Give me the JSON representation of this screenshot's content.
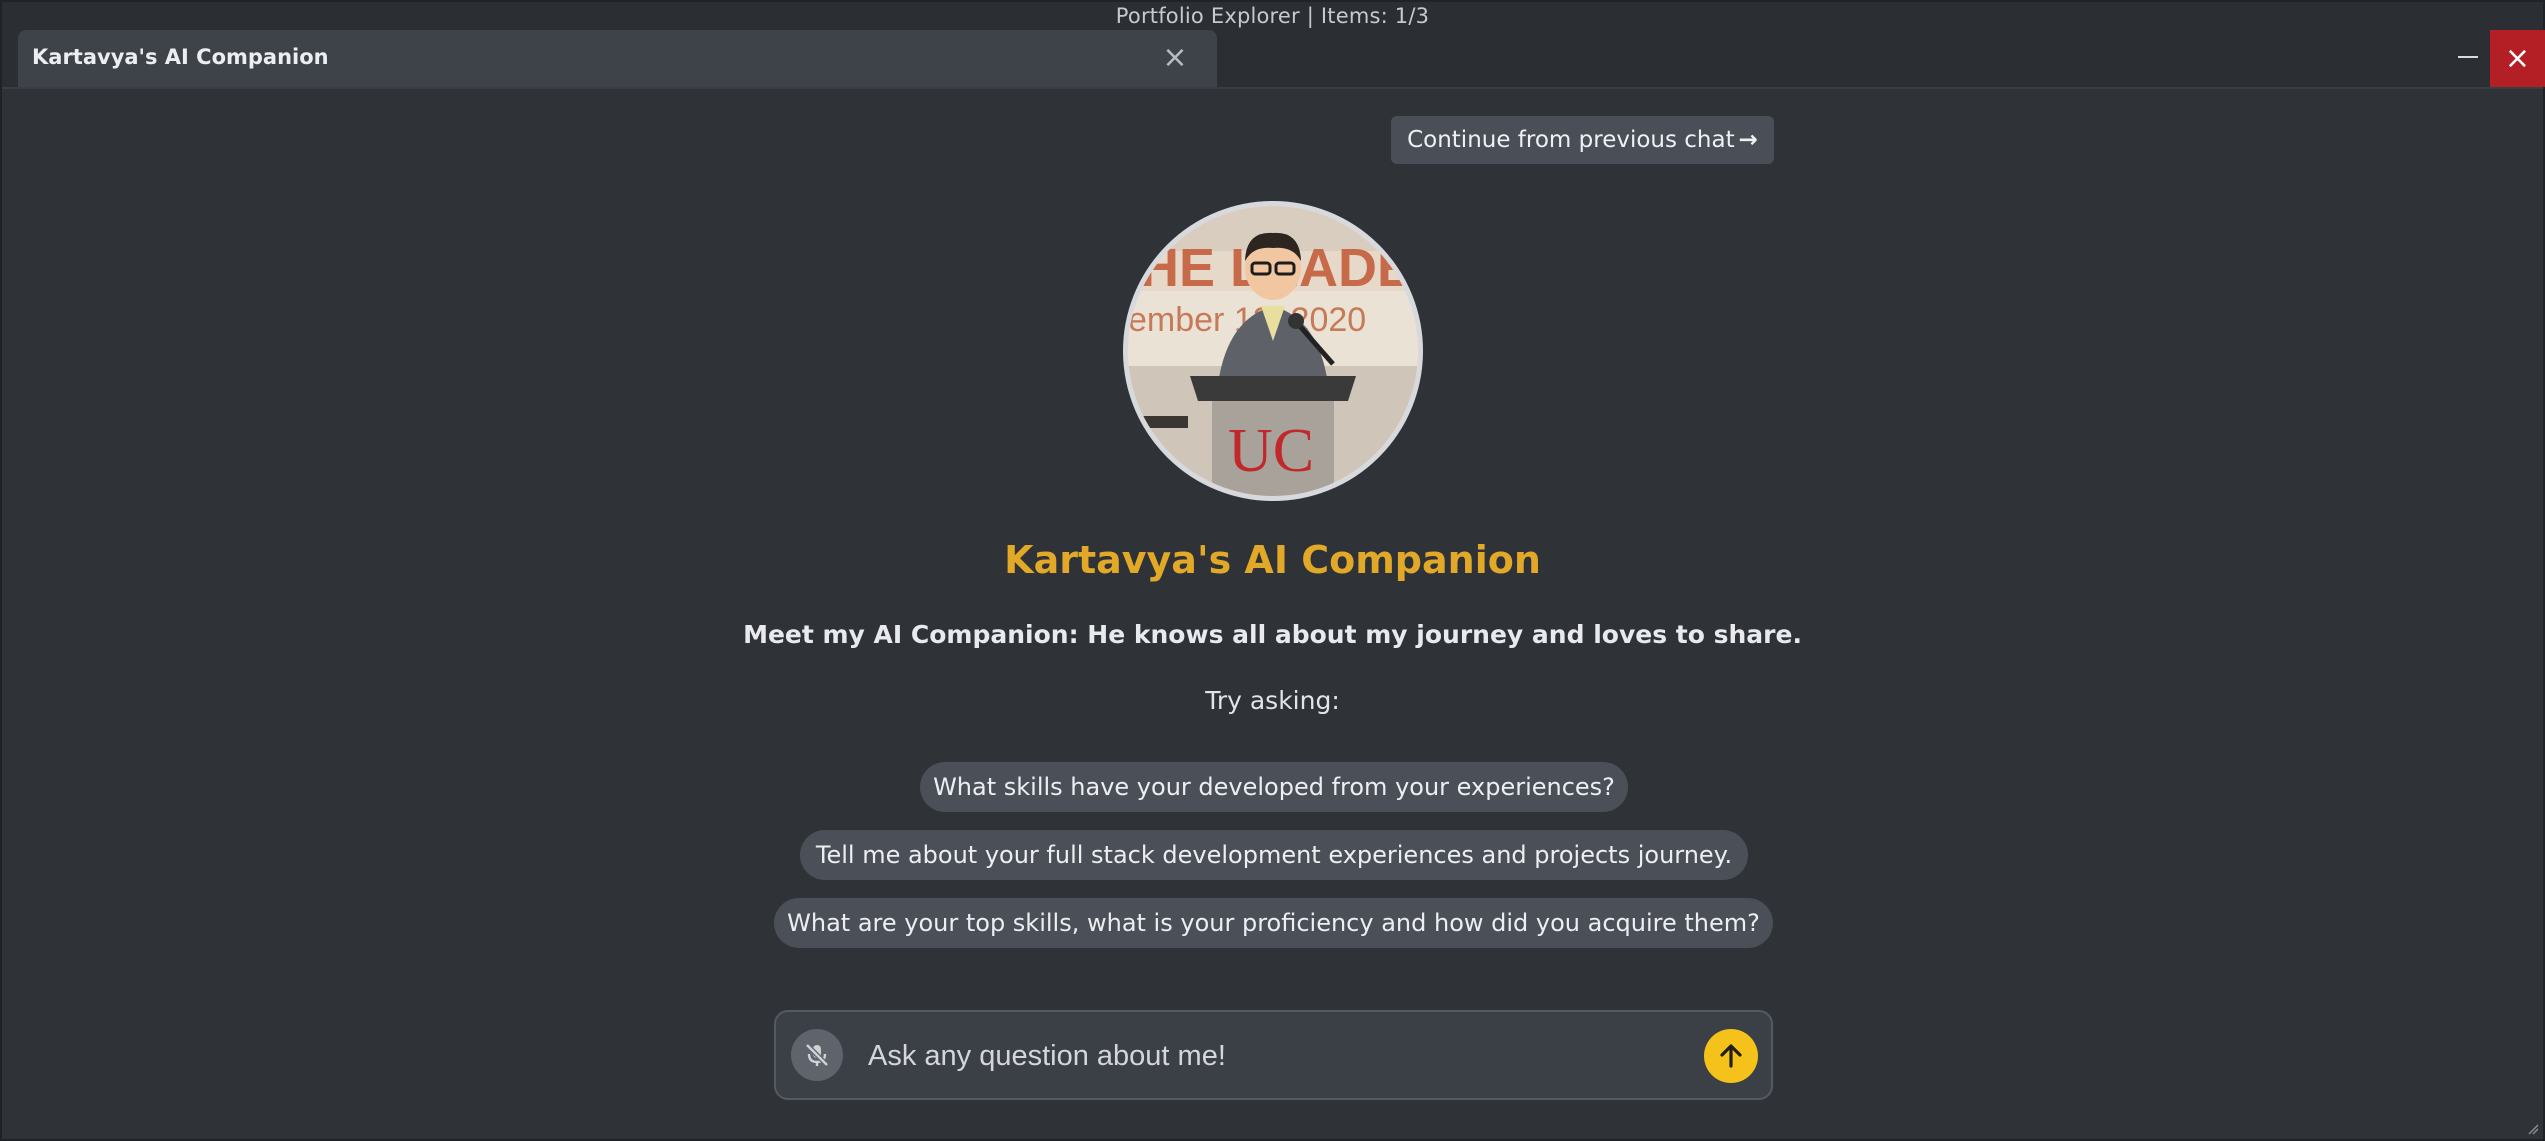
{
  "window": {
    "app_title": "Portfolio Explorer | Items: 1/3",
    "tab_title": "Kartavya's AI Companion",
    "tab_close_icon": "close-icon",
    "minimize_icon": "minimize-icon",
    "close_icon": "close-icon",
    "close_color": "#b31f24"
  },
  "header": {
    "continue_label": "Continue from previous chat",
    "continue_arrow": "→"
  },
  "profile": {
    "title": "Kartavya's AI Companion",
    "tagline": "Meet my AI Companion: He knows all about my journey and loves to share.",
    "try_asking": "Try asking:"
  },
  "suggestions": [
    "What skills have your developed from your experiences?",
    "Tell me about your full stack development experiences and projects journey.",
    "What are your top skills, what is your proficiency and how did you acquire them?"
  ],
  "composer": {
    "placeholder": "Ask any question about me!",
    "value": "",
    "mic_icon": "mic-off-icon",
    "send_icon": "arrow-up-icon",
    "send_color": "#f4c21b"
  },
  "theme": {
    "background": "#2f3237",
    "accent": "#e2a928"
  }
}
